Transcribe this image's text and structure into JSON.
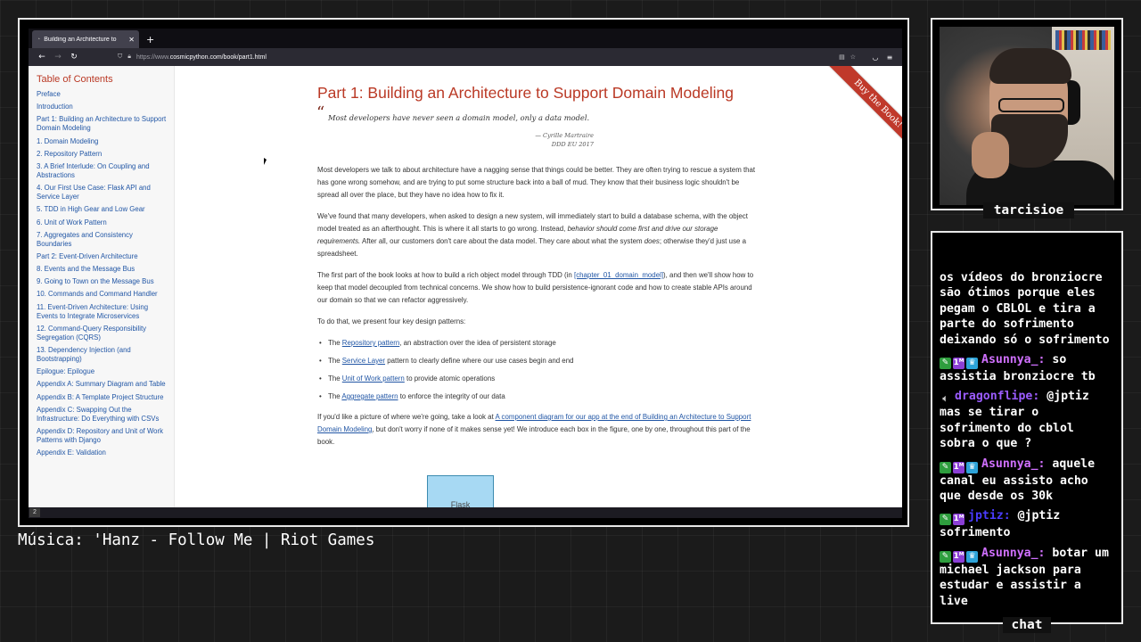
{
  "browser": {
    "tab_title": "Building an Architecture to",
    "new_tab_icon": "plus-icon",
    "url_prefix": "https://www.",
    "url_main": "cosmicpython.com/book/part1.html",
    "page_number": "2"
  },
  "toc": {
    "title": "Table of Contents",
    "items": [
      "Preface",
      "Introduction",
      "Part 1: Building an Architecture to Support Domain Modeling",
      "1. Domain Modeling",
      "2. Repository Pattern",
      "3. A Brief Interlude: On Coupling and Abstractions",
      "4. Our First Use Case: Flask API and Service Layer",
      "5. TDD in High Gear and Low Gear",
      "6. Unit of Work Pattern",
      "7. Aggregates and Consistency Boundaries",
      "Part 2: Event-Driven Architecture",
      "8. Events and the Message Bus",
      "9. Going to Town on the Message Bus",
      "10. Commands and Command Handler",
      "11. Event-Driven Architecture: Using Events to Integrate Microservices",
      "12. Command-Query Responsibility Segregation (CQRS)",
      "13. Dependency Injection (and Bootstrapping)",
      "Epilogue: Epilogue",
      "Appendix A: Summary Diagram and Table",
      "Appendix B: A Template Project Structure",
      "Appendix C: Swapping Out the Infrastructure: Do Everything with CSVs",
      "Appendix D: Repository and Unit of Work Patterns with Django",
      "Appendix E: Validation"
    ]
  },
  "content": {
    "heading": "Part 1: Building an Architecture to Support Domain Modeling",
    "quote": "Most developers have never seen a domain model, only a data model.",
    "quote_author": "— Cyrille Martraire",
    "quote_source": "DDD EU 2017",
    "p1": "Most developers we talk to about architecture have a nagging sense that things could be better. They are often trying to rescue a system that has gone wrong somehow, and are trying to put some structure back into a ball of mud. They know that their business logic shouldn't be spread all over the place, but they have no idea how to fix it.",
    "p2_a": "We've found that many developers, when asked to design a new system, will immediately start to build a database schema, with the object model treated as an afterthought. This is where it all starts to go wrong. Instead, ",
    "p2_em": "behavior should come first and drive our storage requirements.",
    "p2_b": " After all, our customers don't care about the data model. They care about what the system ",
    "p2_em2": "does",
    "p2_c": "; otherwise they'd just use a spreadsheet.",
    "p3_a": "The first part of the book looks at how to build a rich object model through TDD (in ",
    "p3_link": "[chapter_01_domain_model]",
    "p3_b": "), and then we'll show how to keep that model decoupled from technical concerns. We show how to build persistence-ignorant code and how to create stable APIs around our domain so that we can refactor aggressively.",
    "p4": "To do that, we present four key design patterns:",
    "patterns": [
      {
        "pre": "The ",
        "link": "Repository pattern",
        "post": ", an abstraction over the idea of persistent storage"
      },
      {
        "pre": "The ",
        "link": "Service Layer",
        "post": " pattern to clearly define where our use cases begin and end"
      },
      {
        "pre": "The ",
        "link": "Unit of Work pattern",
        "post": " to provide atomic operations"
      },
      {
        "pre": "The ",
        "link": "Aggregate pattern",
        "post": " to enforce the integrity of our data"
      }
    ],
    "p5_a": "If you'd like a picture of where we're going, take a look at ",
    "p5_link": "A component diagram for our app at the end of Building an Architecture to Support Domain Modeling",
    "p5_b": ", but don't worry if none of it makes sense yet! We introduce each box in the figure, one by one, throughout this part of the book.",
    "diagram_label": "Flask",
    "ribbon": "Buy the Book!"
  },
  "overlay": {
    "music": "Música: 'Hanz - Follow Me | Riot Games",
    "streamer": "tarcisioe",
    "chat_label": "chat"
  },
  "chat": [
    {
      "badges": [],
      "user": "",
      "color": "#ffffff",
      "text": "os vídeos do bronziocre são ótimos porque eles pegam o CBLOL e tira a parte do sofrimento deixando só o sofrimento"
    },
    {
      "badges": [
        "pin",
        "sub",
        "crown"
      ],
      "user": "Asunnya_:",
      "color": "#d070ff",
      "text": "so assistia bronziocre tb"
    },
    {
      "badges": [
        "spk"
      ],
      "user": "dragonflipe:",
      "color": "#9b5cff",
      "text": "@jptiz mas se tirar o sofrimento do cblol sobra o que ?"
    },
    {
      "badges": [
        "pin",
        "sub",
        "crown"
      ],
      "user": "Asunnya_:",
      "color": "#d070ff",
      "text": "aquele canal eu assisto acho que desde os 30k"
    },
    {
      "badges": [
        "pin",
        "sub"
      ],
      "user": "jptiz:",
      "color": "#4a3cff",
      "text": "@jptiz sofrimento"
    },
    {
      "badges": [
        "pin",
        "sub",
        "crown"
      ],
      "user": "Asunnya_:",
      "color": "#d070ff",
      "text": "botar um michael jackson para estudar e assistir a live"
    }
  ]
}
